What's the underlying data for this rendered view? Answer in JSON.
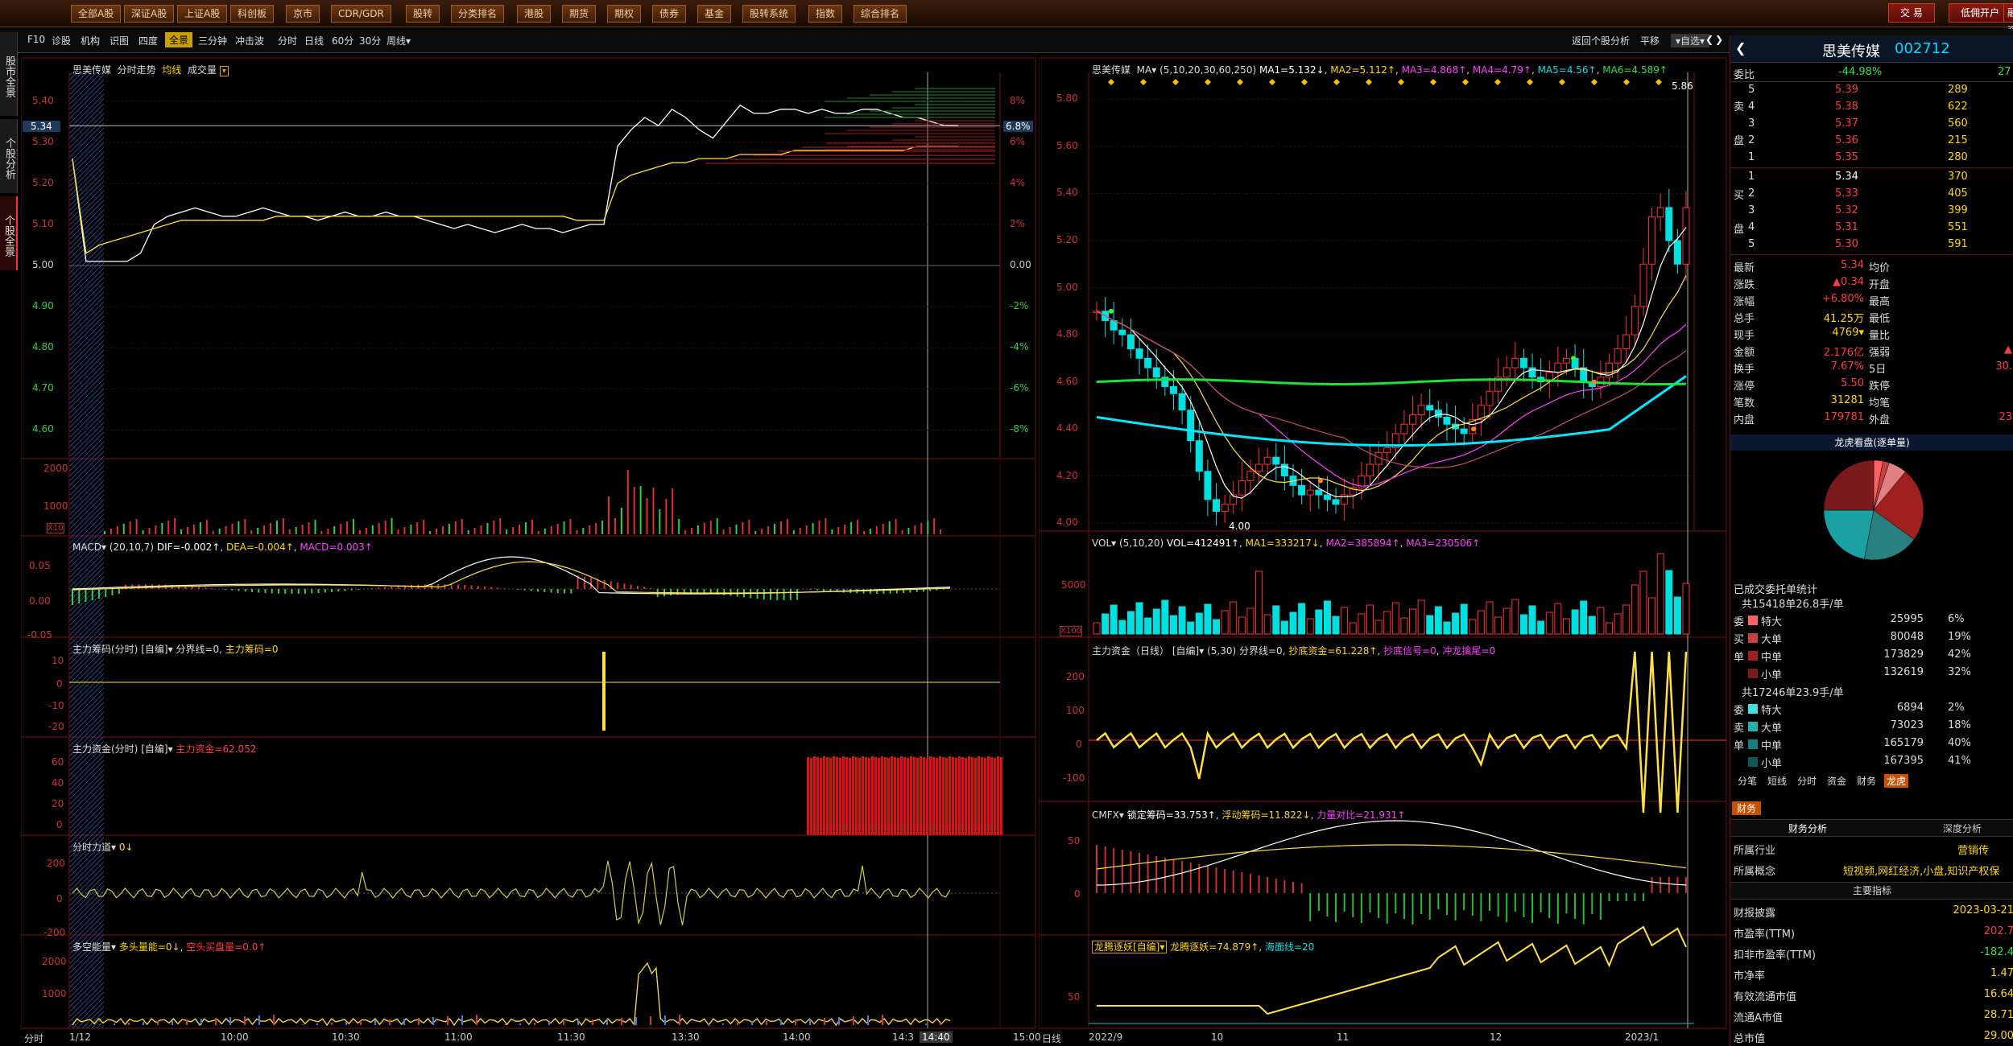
{
  "window": {
    "title": "思美传媒 002712"
  },
  "nav": [
    {
      "label": "全部A股"
    },
    {
      "label": "深证A股"
    },
    {
      "label": "上证A股"
    },
    {
      "label": "科创板"
    },
    {
      "label": "京市"
    },
    {
      "label": "CDR/GDR"
    },
    {
      "label": "股转"
    },
    {
      "label": "分类排名"
    },
    {
      "label": "港股"
    },
    {
      "label": "期货"
    },
    {
      "label": "期权"
    },
    {
      "label": "债券"
    },
    {
      "label": "基金"
    },
    {
      "label": "股转系统"
    },
    {
      "label": "指数"
    },
    {
      "label": "综合排名"
    }
  ],
  "top_right": {
    "trade": "交 易",
    "margin": "低佣开户",
    "more": "融资"
  },
  "toolbar": {
    "left": [
      "F10",
      "诊股",
      "机构",
      "识图",
      "四度",
      "全景",
      "三分钟",
      "冲击波"
    ],
    "active": "全景",
    "periods": [
      "分时",
      "日线",
      "60分",
      "30分",
      "周线▾"
    ],
    "right": [
      "返回个股分析",
      "平移",
      "▾自选▾"
    ]
  },
  "left_tabs": [
    "股市全景",
    "个股分析",
    "个股全景"
  ],
  "intraday": {
    "title": "思美传媒",
    "subtitle": "分时走势",
    "avg_label": "均线",
    "vol_label": "成交量",
    "price_ticks": [
      "5.40",
      "5.30",
      "5.20",
      "5.10",
      "5.00",
      "4.90",
      "4.80",
      "4.70",
      "4.60"
    ],
    "pct_ticks": [
      "8%",
      "6%",
      "4%",
      "2%",
      "0.00",
      "-2%",
      "-4%",
      "-6%",
      "-8%"
    ],
    "current_price": "5.34",
    "current_pct": "6.8%",
    "vol_ticks": [
      "2000",
      "1000"
    ],
    "vol_unit": "X10",
    "time_ticks": [
      "1/12",
      "10:00",
      "10:30",
      "11:00",
      "11:30",
      "13:30",
      "14:00",
      "14:3",
      "14:40",
      "15:00"
    ],
    "time_footer": "分时",
    "prices": [
      5.26,
      5.01,
      5.01,
      5.01,
      5.01,
      5.03,
      5.1,
      5.12,
      5.13,
      5.14,
      5.13,
      5.12,
      5.12,
      5.13,
      5.14,
      5.13,
      5.12,
      5.12,
      5.11,
      5.12,
      5.13,
      5.12,
      5.12,
      5.13,
      5.12,
      5.12,
      5.11,
      5.1,
      5.09,
      5.1,
      5.09,
      5.08,
      5.09,
      5.1,
      5.09,
      5.09,
      5.08,
      5.09,
      5.1,
      5.1,
      5.29,
      5.33,
      5.36,
      5.34,
      5.38,
      5.36,
      5.33,
      5.31,
      5.35,
      5.39,
      5.37,
      5.37,
      5.38,
      5.38,
      5.37,
      5.38,
      5.37,
      5.37,
      5.38,
      5.38,
      5.37,
      5.36,
      5.36,
      5.35,
      5.34,
      5.34
    ],
    "avg": [
      5.26,
      5.03,
      5.05,
      5.06,
      5.07,
      5.08,
      5.09,
      5.1,
      5.11,
      5.11,
      5.11,
      5.11,
      5.11,
      5.11,
      5.11,
      5.12,
      5.12,
      5.12,
      5.12,
      5.12,
      5.12,
      5.12,
      5.12,
      5.12,
      5.12,
      5.12,
      5.12,
      5.12,
      5.12,
      5.12,
      5.12,
      5.12,
      5.12,
      5.12,
      5.12,
      5.12,
      5.12,
      5.11,
      5.11,
      5.11,
      5.2,
      5.22,
      5.23,
      5.24,
      5.25,
      5.25,
      5.26,
      5.26,
      5.26,
      5.27,
      5.27,
      5.27,
      5.27,
      5.28,
      5.28,
      5.28,
      5.28,
      5.28,
      5.28,
      5.28,
      5.28,
      5.28,
      5.29,
      5.29,
      5.29,
      5.29
    ]
  },
  "intraday_indicators": {
    "macd": {
      "title": "MACD▾",
      "params": "(20,10,7)",
      "dif": "DIF=-0.002↑",
      "dea": "DEA=-0.004↑",
      "macd": "MACD=0.003↑",
      "ticks": [
        "0.05",
        "0.00",
        "-0.05"
      ]
    },
    "chip": {
      "title": "主力筹码(分时)",
      "edit": "[自编]▾",
      "line": "分界线=0",
      "val": "主力筹码=0",
      "ticks": [
        "10",
        "0",
        "-10",
        "-20"
      ]
    },
    "fund": {
      "title": "主力资金(分时)",
      "edit": "[自编]▾",
      "val": "主力资金=62.052",
      "ticks": [
        "60",
        "40",
        "20",
        "0"
      ]
    },
    "force": {
      "title": "分时力道▾",
      "val": "0↓",
      "ticks": [
        "200",
        "0",
        "-200"
      ]
    },
    "energy": {
      "title": "多空能量▾",
      "bull": "多头量能=0↓",
      "bear": "空头买盘量=0.0↑",
      "ticks": [
        "2000",
        "1000"
      ]
    }
  },
  "kline": {
    "title": "思美传媒",
    "ma": "MA▾",
    "params": "(5,10,20,30,60,250)",
    "ma1": "MA1=5.132↓",
    "ma2": "MA2=5.112↑",
    "ma3": "MA3=4.868↑",
    "ma4": "MA4=4.79↑",
    "ma5": "MA5=4.56↑",
    "ma6": "MA6=4.589↑",
    "price_ticks": [
      "5.80",
      "5.60",
      "5.40",
      "5.20",
      "5.00",
      "4.80",
      "4.60",
      "4.40",
      "4.20",
      "4.00"
    ],
    "high_label": "5.86",
    "low_label": "4.00",
    "date_ticks": [
      "2022/9",
      "10",
      "11",
      "12",
      "2023/1"
    ],
    "footer": "日线",
    "closes": [
      4.9,
      4.86,
      4.82,
      4.8,
      4.74,
      4.7,
      4.66,
      4.62,
      4.58,
      4.55,
      4.48,
      4.35,
      4.22,
      4.1,
      4.05,
      4.08,
      4.12,
      4.18,
      4.22,
      4.25,
      4.28,
      4.25,
      4.2,
      4.16,
      4.12,
      4.14,
      4.12,
      4.1,
      4.08,
      4.12,
      4.15,
      4.2,
      4.25,
      4.3,
      4.32,
      4.38,
      4.42,
      4.46,
      4.5,
      4.48,
      4.45,
      4.42,
      4.4,
      4.38,
      4.44,
      4.5,
      4.56,
      4.62,
      4.66,
      4.7,
      4.66,
      4.62,
      4.6,
      4.64,
      4.68,
      4.7,
      4.66,
      4.6,
      4.58,
      4.62,
      4.68,
      4.74,
      4.8,
      4.92,
      5.1,
      5.3,
      5.34,
      5.2,
      5.1,
      5.34
    ]
  },
  "kline_indicators": {
    "vol": {
      "title": "VOL▾",
      "params": "(5,10,20)",
      "vol": "VOL=412491↑",
      "ma1": "MA1=333217↓",
      "ma2": "MA2=385894↑",
      "ma3": "MA3=230506↑",
      "ticks": [
        "5000"
      ],
      "unit": "X100"
    },
    "fund": {
      "title": "主力资金（日线）",
      "edit": "[自编]▾",
      "params": "(5,30)",
      "line": "分界线=0",
      "bottom": "抄底资金=61.228↑",
      "signal": "抄底信号=0",
      "chase": "冲龙擒尾=0",
      "ticks": [
        "200",
        "100",
        "0",
        "-100"
      ]
    },
    "cmfx": {
      "title": "CMFX▾",
      "lock": "锁定筹码=33.753↑",
      "float": "浮动筹码=11.822↓",
      "ratio": "力量对比=21.931↑",
      "ticks": [
        "50",
        "0"
      ]
    },
    "dragon": {
      "title": "龙腾逐妖[自编]▾",
      "val": "龙腾逐妖=74.879↑",
      "sea": "海面线=20",
      "ticks": [
        "50"
      ]
    }
  },
  "sidebar": {
    "name": "思美传媒",
    "code": "002712",
    "weibi_label": "委比",
    "weibi_val": "-44.98%",
    "weibi_diff": "27",
    "sell": [
      {
        "lvl": "5",
        "p": "5.39",
        "v": "289"
      },
      {
        "lvl": "4",
        "p": "5.38",
        "v": "622"
      },
      {
        "lvl": "3",
        "p": "5.37",
        "v": "560"
      },
      {
        "lvl": "2",
        "p": "5.36",
        "v": "215"
      },
      {
        "lvl": "1",
        "p": "5.35",
        "v": "280"
      }
    ],
    "buy": [
      {
        "lvl": "1",
        "p": "5.34",
        "v": "370"
      },
      {
        "lvl": "2",
        "p": "5.33",
        "v": "405"
      },
      {
        "lvl": "3",
        "p": "5.32",
        "v": "399"
      },
      {
        "lvl": "4",
        "p": "5.31",
        "v": "551"
      },
      {
        "lvl": "5",
        "p": "5.30",
        "v": "591"
      }
    ],
    "sell_side_label": "卖",
    "buy_side_label": "买",
    "pan_label": "盘",
    "quote": [
      {
        "k": "最新",
        "v": "5.34",
        "k2": "均价",
        "v2": ""
      },
      {
        "k": "涨跌",
        "v": "▲0.34",
        "k2": "开盘",
        "v2": ""
      },
      {
        "k": "涨幅",
        "v": "+6.80%",
        "k2": "最高",
        "v2": ""
      },
      {
        "k": "总手",
        "v": "41.25万",
        "k2": "最低",
        "v2": ""
      },
      {
        "k": "现手",
        "v": "4769▾",
        "k2": "量比",
        "v2": ""
      },
      {
        "k": "金额",
        "v": "2.176亿",
        "k2": "强弱",
        "v2": "▲"
      },
      {
        "k": "换手",
        "v": "7.67%",
        "k2": "5日",
        "v2": "30."
      },
      {
        "k": "涨停",
        "v": "5.50",
        "k2": "跌停",
        "v2": ""
      },
      {
        "k": "笔数",
        "v": "31281",
        "k2": "均笔",
        "v2": ""
      },
      {
        "k": "内盘",
        "v": "179781",
        "k2": "外盘",
        "v2": "23"
      }
    ],
    "pie_title": "龙虎看盘(逐单量)",
    "pie_values": [
      3,
      2,
      6,
      24,
      18,
      22,
      25
    ],
    "pie_colors": [
      "#ff6060",
      "#c84040",
      "#e08080",
      "#a02020",
      "#2a8080",
      "#1aa0a0",
      "#7a1a1a"
    ],
    "stats_title": "已成交委托单统计",
    "sell_total": "共15418单26.8手/单",
    "sell_rows": [
      {
        "n": "特大",
        "v": "25995",
        "p": "6%"
      },
      {
        "n": "大单",
        "v": "80048",
        "p": "19%"
      },
      {
        "n": "中单",
        "v": "173829",
        "p": "42%"
      },
      {
        "n": "小单",
        "v": "132619",
        "p": "32%"
      }
    ],
    "buy_total": "共17246单23.9手/单",
    "buy_rows": [
      {
        "n": "特大",
        "v": "6894",
        "p": "2%"
      },
      {
        "n": "大单",
        "v": "73023",
        "p": "18%"
      },
      {
        "n": "中单",
        "v": "165179",
        "p": "40%"
      },
      {
        "n": "小单",
        "v": "167395",
        "p": "41%"
      }
    ],
    "side_labels_sell": [
      "委",
      "买",
      "单"
    ],
    "side_labels_buy": [
      "委",
      "卖",
      "单"
    ],
    "tabs": [
      "分笔",
      "短线",
      "分时",
      "资金",
      "财务",
      "龙虎"
    ],
    "active_tab": "龙虎",
    "fin_tab": "财务",
    "fin_sub": [
      "财务分析",
      "深度分析"
    ],
    "industry_label": "所属行业",
    "industry": "营销传",
    "concept_label": "所属概念",
    "concept": "短视频,网红经济,小盘,知识产权保",
    "main_title": "主要指标",
    "fin": [
      {
        "k": "财报披露",
        "v": "2023-03-21"
      },
      {
        "k": "市盈率(TTM)",
        "v": "202.7"
      },
      {
        "k": "扣非市盈率(TTM)",
        "v": "-182.4"
      },
      {
        "k": "市净率",
        "v": "1.47"
      },
      {
        "k": "有效流通市值",
        "v": "16.64"
      },
      {
        "k": "流通A市值",
        "v": "28.71"
      },
      {
        "k": "总市值",
        "v": "29.00"
      }
    ]
  }
}
